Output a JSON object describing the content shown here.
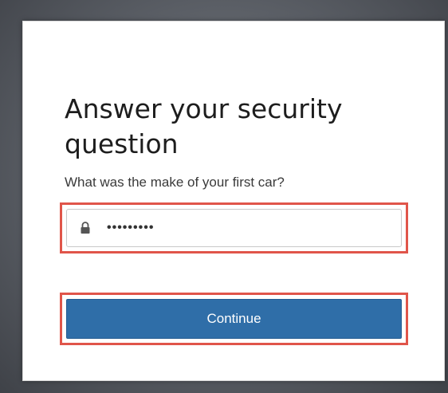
{
  "dialog": {
    "title": "Answer your security question",
    "question": "What was the make of your first car?",
    "answer_value": "•••••••••",
    "lock_icon": "lock-icon",
    "continue_label": "Continue"
  },
  "colors": {
    "highlight": "#e0554a",
    "button": "#2f6ea8",
    "button_text": "#ffffff"
  }
}
